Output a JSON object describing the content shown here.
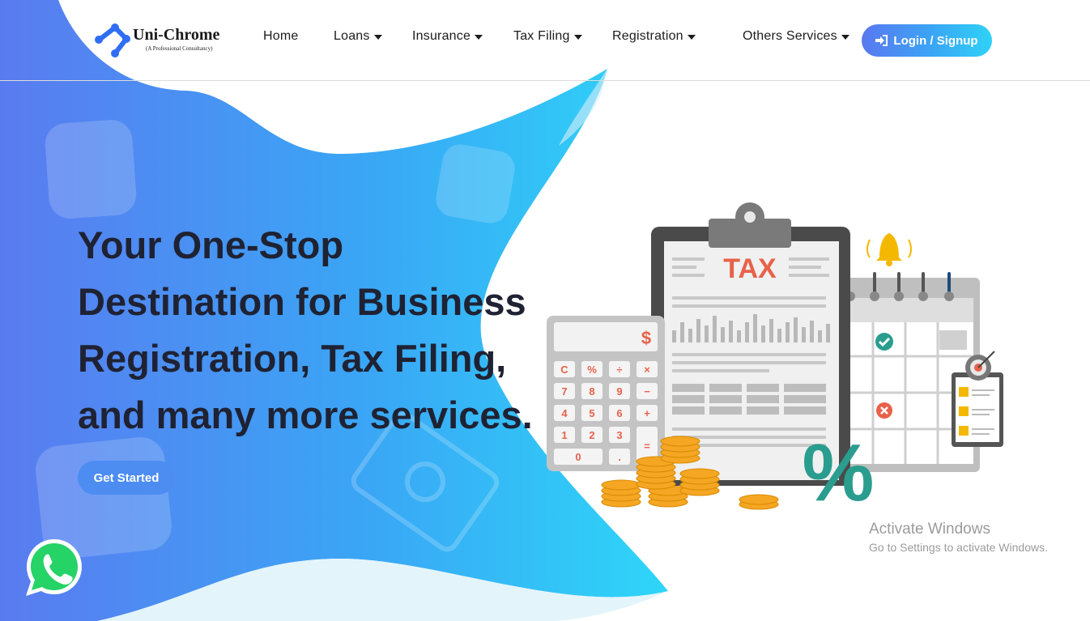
{
  "brand": {
    "name": "Uni-Chrome",
    "tagline": "(A Professional Consultancy)",
    "colors": {
      "primary": "#3f87f5",
      "accent": "#2fd2f7",
      "dark_text": "#1f2233"
    }
  },
  "nav": {
    "items": [
      {
        "label": "Home",
        "has_dropdown": false
      },
      {
        "label": "Loans",
        "has_dropdown": true
      },
      {
        "label": "Insurance",
        "has_dropdown": true
      },
      {
        "label": "Tax Filing",
        "has_dropdown": true
      },
      {
        "label": "Registration",
        "has_dropdown": true
      },
      {
        "label": "Others Services",
        "has_dropdown": true
      }
    ],
    "login_label": "Login / Signup",
    "login_icon": "sign-in-icon"
  },
  "hero": {
    "title_lines": [
      "Your One-Stop",
      "Destination for Business",
      "Registration, Tax Filing,",
      "and many more services."
    ],
    "cta_label": "Get Started"
  },
  "illustration": {
    "doc_title": "TAX",
    "calc_display": "$",
    "calc_keys": [
      "C",
      "%",
      "÷",
      "×",
      "7",
      "8",
      "9",
      "−",
      "4",
      "5",
      "6",
      "+",
      "1",
      "2",
      "3",
      "=",
      "0",
      "."
    ],
    "percent_symbol": "%",
    "icons": [
      "bell-icon",
      "check-icon",
      "cross-icon",
      "target-icon",
      "coins-icon"
    ]
  },
  "floating": {
    "whatsapp_icon": "whatsapp-icon"
  },
  "watermark": {
    "title": "Activate Windows",
    "subtitle": "Go to Settings to activate Windows."
  }
}
